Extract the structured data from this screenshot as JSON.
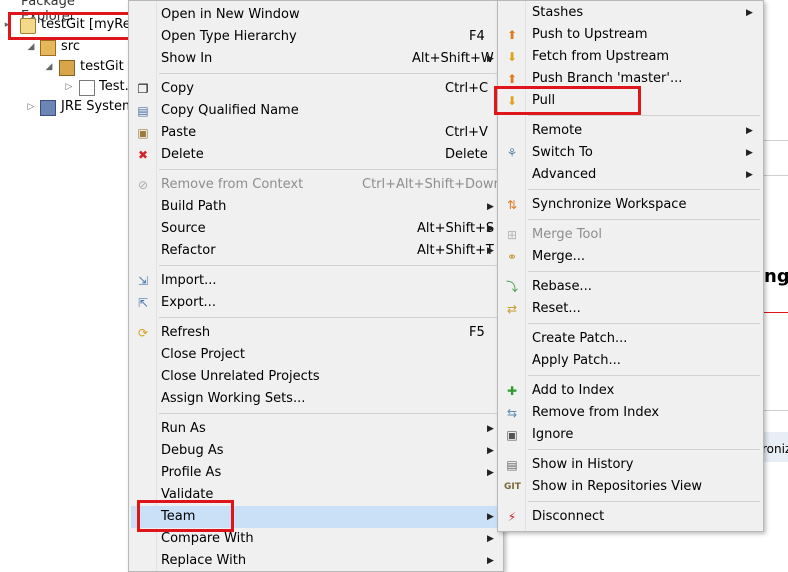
{
  "explorer": {
    "title": "Package Explorer",
    "items": [
      {
        "label": "testGit  [myRep",
        "indent": 0
      },
      {
        "label": "src",
        "indent": 1
      },
      {
        "label": "testGit",
        "indent": 2
      },
      {
        "label": "Test.j",
        "indent": 3
      },
      {
        "label": "JRE System",
        "indent": 1
      }
    ]
  },
  "context_menu": {
    "items": [
      {
        "label": "Open in New Window",
        "shortcut": ""
      },
      {
        "label": "Open Type Hierarchy",
        "shortcut": "F4"
      },
      {
        "label": "Show In",
        "shortcut": "Alt+Shift+W"
      },
      {
        "label": "Copy",
        "shortcut": "Ctrl+C"
      },
      {
        "label": "Copy Qualified Name",
        "shortcut": ""
      },
      {
        "label": "Paste",
        "shortcut": "Ctrl+V"
      },
      {
        "label": "Delete",
        "shortcut": "Delete"
      },
      {
        "label": "Remove from Context",
        "shortcut": "Ctrl+Alt+Shift+Down"
      },
      {
        "label": "Build Path",
        "shortcut": ""
      },
      {
        "label": "Source",
        "shortcut": "Alt+Shift+S"
      },
      {
        "label": "Refactor",
        "shortcut": "Alt+Shift+T"
      },
      {
        "label": "Import...",
        "shortcut": ""
      },
      {
        "label": "Export...",
        "shortcut": ""
      },
      {
        "label": "Refresh",
        "shortcut": "F5"
      },
      {
        "label": "Close Project",
        "shortcut": ""
      },
      {
        "label": "Close Unrelated Projects",
        "shortcut": ""
      },
      {
        "label": "Assign Working Sets...",
        "shortcut": ""
      },
      {
        "label": "Run As",
        "shortcut": ""
      },
      {
        "label": "Debug As",
        "shortcut": ""
      },
      {
        "label": "Profile As",
        "shortcut": ""
      },
      {
        "label": "Validate",
        "shortcut": ""
      },
      {
        "label": "Team",
        "shortcut": ""
      },
      {
        "label": "Compare With",
        "shortcut": ""
      },
      {
        "label": "Replace With",
        "shortcut": ""
      }
    ]
  },
  "team_menu": {
    "items": [
      {
        "label": "Stashes"
      },
      {
        "label": "Push to Upstream"
      },
      {
        "label": "Fetch from Upstream"
      },
      {
        "label": "Push Branch 'master'..."
      },
      {
        "label": "Pull"
      },
      {
        "label": "Remote"
      },
      {
        "label": "Switch To"
      },
      {
        "label": "Advanced"
      },
      {
        "label": "Synchronize Workspace"
      },
      {
        "label": "Merge Tool"
      },
      {
        "label": "Merge..."
      },
      {
        "label": "Rebase..."
      },
      {
        "label": "Reset..."
      },
      {
        "label": "Create Patch..."
      },
      {
        "label": "Apply Patch..."
      },
      {
        "label": "Add to Index"
      },
      {
        "label": "Remove from Index"
      },
      {
        "label": "Ignore"
      },
      {
        "label": "Show in History"
      },
      {
        "label": "Show in Repositories View"
      },
      {
        "label": "Disconnect"
      }
    ]
  },
  "background": {
    "fragment_1": "ng|",
    "fragment_2": "roniz"
  },
  "colors": {
    "highlight_box": "#e0141b",
    "menu_bg": "#f0f0f0"
  }
}
